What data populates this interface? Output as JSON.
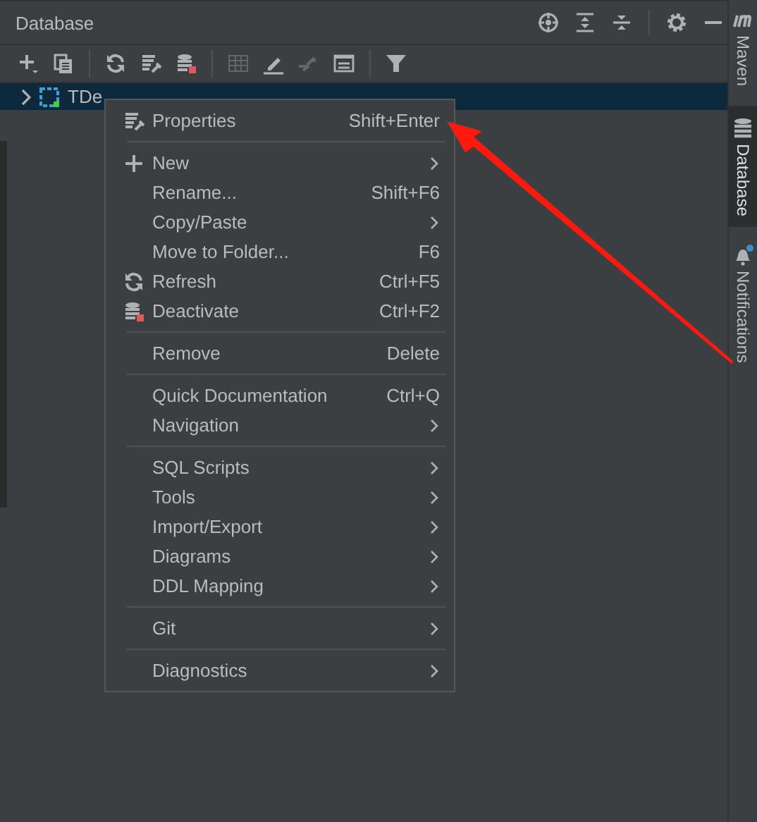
{
  "panel": {
    "title": "Database",
    "actions": [
      {
        "kind": "locate"
      },
      {
        "kind": "expand"
      },
      {
        "kind": "collapse"
      },
      {
        "kind": "separator"
      },
      {
        "kind": "settings"
      },
      {
        "kind": "minimize"
      }
    ]
  },
  "toolbar": [
    [
      {
        "kind": "add",
        "disabled": false
      },
      {
        "kind": "copy",
        "disabled": false
      }
    ],
    [
      {
        "kind": "refresh",
        "disabled": false
      },
      {
        "kind": "properties",
        "disabled": false
      },
      {
        "kind": "deactivate",
        "disabled": false
      }
    ],
    [
      {
        "kind": "table",
        "disabled": true
      },
      {
        "kind": "edit",
        "disabled": false
      },
      {
        "kind": "jump",
        "disabled": true
      },
      {
        "kind": "console",
        "disabled": false
      }
    ],
    [
      {
        "kind": "filter",
        "disabled": false
      }
    ]
  ],
  "tree": [
    {
      "label": "TDe",
      "expanded": false,
      "selected": true
    }
  ],
  "side_tabs": [
    {
      "label": "Maven",
      "kind": "maven",
      "selected": false
    },
    {
      "label": "Database",
      "kind": "database",
      "selected": true
    },
    {
      "label": "Notifications",
      "kind": "bell",
      "selected": false
    }
  ],
  "context_menu": {
    "groups": [
      [
        {
          "label": "Properties",
          "shortcut": "Shift+Enter",
          "submenu": false,
          "kind": "properties"
        }
      ],
      [
        {
          "label": "New",
          "submenu": true,
          "kind": "plus"
        },
        {
          "label": "Rename...",
          "shortcut": "Shift+F6",
          "submenu": false
        },
        {
          "label": "Copy/Paste",
          "submenu": true
        },
        {
          "label": "Move to Folder...",
          "shortcut": "F6",
          "submenu": false
        },
        {
          "label": "Refresh",
          "shortcut": "Ctrl+F5",
          "submenu": false,
          "kind": "refresh"
        },
        {
          "label": "Deactivate",
          "shortcut": "Ctrl+F2",
          "submenu": false,
          "kind": "deactivate"
        }
      ],
      [
        {
          "label": "Remove",
          "shortcut": "Delete",
          "submenu": false
        }
      ],
      [
        {
          "label": "Quick Documentation",
          "shortcut": "Ctrl+Q",
          "submenu": false
        },
        {
          "label": "Navigation",
          "submenu": true
        }
      ],
      [
        {
          "label": "SQL Scripts",
          "submenu": true
        },
        {
          "label": "Tools",
          "submenu": true
        },
        {
          "label": "Import/Export",
          "submenu": true
        },
        {
          "label": "Diagrams",
          "submenu": true
        },
        {
          "label": "DDL Mapping",
          "submenu": true
        }
      ],
      [
        {
          "label": "Git",
          "submenu": true
        }
      ],
      [
        {
          "label": "Diagnostics",
          "submenu": true
        }
      ]
    ]
  }
}
